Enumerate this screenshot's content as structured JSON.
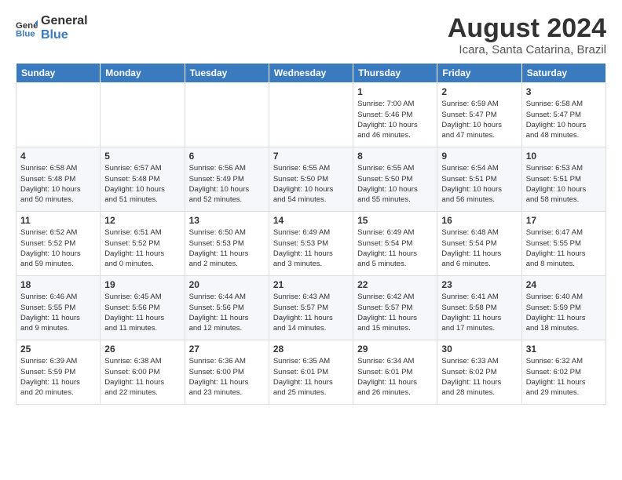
{
  "header": {
    "logo_line1": "General",
    "logo_line2": "Blue",
    "month_year": "August 2024",
    "location": "Icara, Santa Catarina, Brazil"
  },
  "weekdays": [
    "Sunday",
    "Monday",
    "Tuesday",
    "Wednesday",
    "Thursday",
    "Friday",
    "Saturday"
  ],
  "weeks": [
    [
      {
        "day": "",
        "info": ""
      },
      {
        "day": "",
        "info": ""
      },
      {
        "day": "",
        "info": ""
      },
      {
        "day": "",
        "info": ""
      },
      {
        "day": "1",
        "info": "Sunrise: 7:00 AM\nSunset: 5:46 PM\nDaylight: 10 hours\nand 46 minutes."
      },
      {
        "day": "2",
        "info": "Sunrise: 6:59 AM\nSunset: 5:47 PM\nDaylight: 10 hours\nand 47 minutes."
      },
      {
        "day": "3",
        "info": "Sunrise: 6:58 AM\nSunset: 5:47 PM\nDaylight: 10 hours\nand 48 minutes."
      }
    ],
    [
      {
        "day": "4",
        "info": "Sunrise: 6:58 AM\nSunset: 5:48 PM\nDaylight: 10 hours\nand 50 minutes."
      },
      {
        "day": "5",
        "info": "Sunrise: 6:57 AM\nSunset: 5:48 PM\nDaylight: 10 hours\nand 51 minutes."
      },
      {
        "day": "6",
        "info": "Sunrise: 6:56 AM\nSunset: 5:49 PM\nDaylight: 10 hours\nand 52 minutes."
      },
      {
        "day": "7",
        "info": "Sunrise: 6:55 AM\nSunset: 5:50 PM\nDaylight: 10 hours\nand 54 minutes."
      },
      {
        "day": "8",
        "info": "Sunrise: 6:55 AM\nSunset: 5:50 PM\nDaylight: 10 hours\nand 55 minutes."
      },
      {
        "day": "9",
        "info": "Sunrise: 6:54 AM\nSunset: 5:51 PM\nDaylight: 10 hours\nand 56 minutes."
      },
      {
        "day": "10",
        "info": "Sunrise: 6:53 AM\nSunset: 5:51 PM\nDaylight: 10 hours\nand 58 minutes."
      }
    ],
    [
      {
        "day": "11",
        "info": "Sunrise: 6:52 AM\nSunset: 5:52 PM\nDaylight: 10 hours\nand 59 minutes."
      },
      {
        "day": "12",
        "info": "Sunrise: 6:51 AM\nSunset: 5:52 PM\nDaylight: 11 hours\nand 0 minutes."
      },
      {
        "day": "13",
        "info": "Sunrise: 6:50 AM\nSunset: 5:53 PM\nDaylight: 11 hours\nand 2 minutes."
      },
      {
        "day": "14",
        "info": "Sunrise: 6:49 AM\nSunset: 5:53 PM\nDaylight: 11 hours\nand 3 minutes."
      },
      {
        "day": "15",
        "info": "Sunrise: 6:49 AM\nSunset: 5:54 PM\nDaylight: 11 hours\nand 5 minutes."
      },
      {
        "day": "16",
        "info": "Sunrise: 6:48 AM\nSunset: 5:54 PM\nDaylight: 11 hours\nand 6 minutes."
      },
      {
        "day": "17",
        "info": "Sunrise: 6:47 AM\nSunset: 5:55 PM\nDaylight: 11 hours\nand 8 minutes."
      }
    ],
    [
      {
        "day": "18",
        "info": "Sunrise: 6:46 AM\nSunset: 5:55 PM\nDaylight: 11 hours\nand 9 minutes."
      },
      {
        "day": "19",
        "info": "Sunrise: 6:45 AM\nSunset: 5:56 PM\nDaylight: 11 hours\nand 11 minutes."
      },
      {
        "day": "20",
        "info": "Sunrise: 6:44 AM\nSunset: 5:56 PM\nDaylight: 11 hours\nand 12 minutes."
      },
      {
        "day": "21",
        "info": "Sunrise: 6:43 AM\nSunset: 5:57 PM\nDaylight: 11 hours\nand 14 minutes."
      },
      {
        "day": "22",
        "info": "Sunrise: 6:42 AM\nSunset: 5:57 PM\nDaylight: 11 hours\nand 15 minutes."
      },
      {
        "day": "23",
        "info": "Sunrise: 6:41 AM\nSunset: 5:58 PM\nDaylight: 11 hours\nand 17 minutes."
      },
      {
        "day": "24",
        "info": "Sunrise: 6:40 AM\nSunset: 5:59 PM\nDaylight: 11 hours\nand 18 minutes."
      }
    ],
    [
      {
        "day": "25",
        "info": "Sunrise: 6:39 AM\nSunset: 5:59 PM\nDaylight: 11 hours\nand 20 minutes."
      },
      {
        "day": "26",
        "info": "Sunrise: 6:38 AM\nSunset: 6:00 PM\nDaylight: 11 hours\nand 22 minutes."
      },
      {
        "day": "27",
        "info": "Sunrise: 6:36 AM\nSunset: 6:00 PM\nDaylight: 11 hours\nand 23 minutes."
      },
      {
        "day": "28",
        "info": "Sunrise: 6:35 AM\nSunset: 6:01 PM\nDaylight: 11 hours\nand 25 minutes."
      },
      {
        "day": "29",
        "info": "Sunrise: 6:34 AM\nSunset: 6:01 PM\nDaylight: 11 hours\nand 26 minutes."
      },
      {
        "day": "30",
        "info": "Sunrise: 6:33 AM\nSunset: 6:02 PM\nDaylight: 11 hours\nand 28 minutes."
      },
      {
        "day": "31",
        "info": "Sunrise: 6:32 AM\nSunset: 6:02 PM\nDaylight: 11 hours\nand 29 minutes."
      }
    ]
  ]
}
